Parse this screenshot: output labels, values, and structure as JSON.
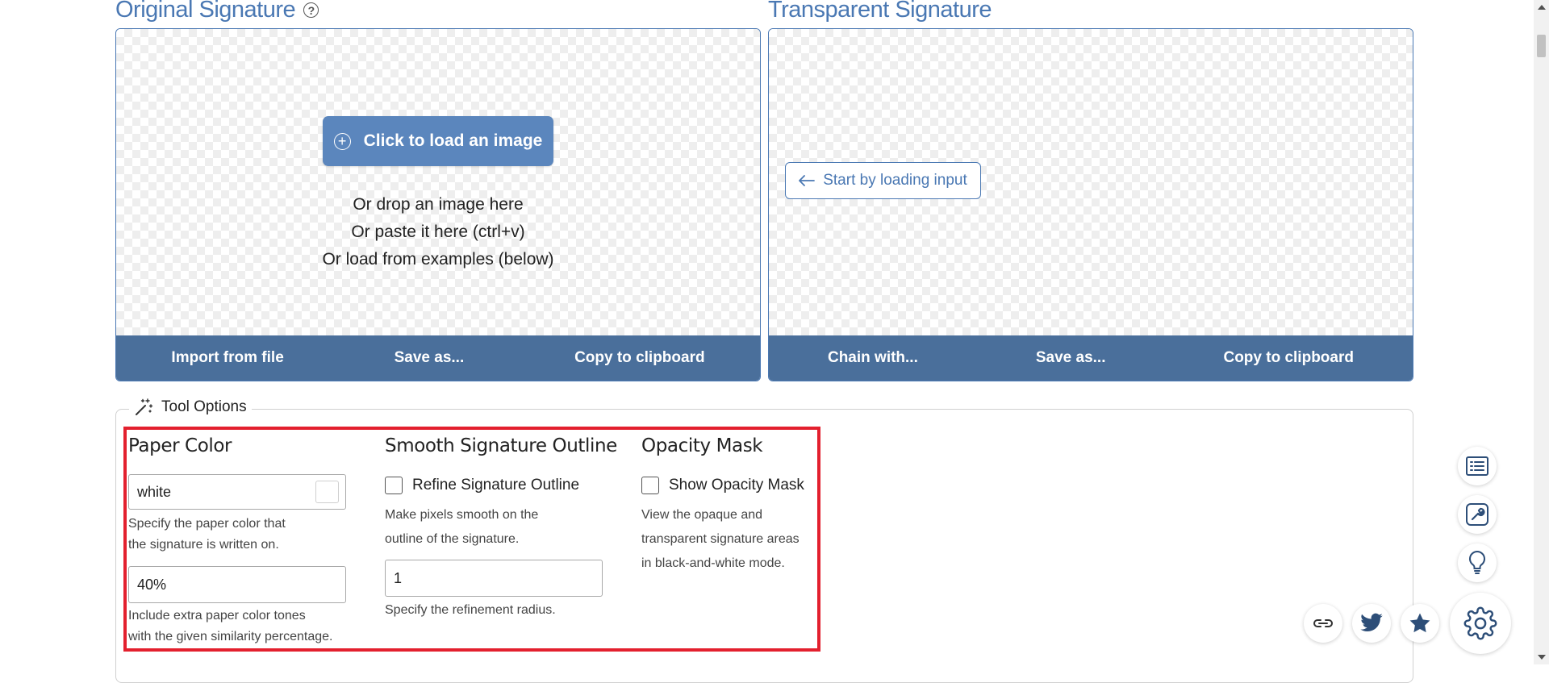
{
  "input_panel": {
    "title": "Original Signature",
    "load_button_label": "Click to load an image",
    "drop_lines": [
      "Or drop an image here",
      "Or paste it here (ctrl+v)",
      "Or load from examples (below)"
    ],
    "toolbar": [
      "Import from file",
      "Save as...",
      "Copy to clipboard"
    ]
  },
  "output_panel": {
    "title": "Transparent Signature",
    "start_button_label": "Start by loading input",
    "toolbar": [
      "Chain with...",
      "Save as...",
      "Copy to clipboard"
    ]
  },
  "tool_options": {
    "legend": "Tool Options",
    "paper_color": {
      "heading": "Paper Color",
      "color_value": "white",
      "color_desc": [
        "Specify the paper color that",
        "the signature is written on."
      ],
      "similarity_value": "40%",
      "similarity_desc": [
        "Include extra paper color tones",
        "with the given similarity percentage."
      ]
    },
    "smooth_outline": {
      "heading": "Smooth Signature Outline",
      "checkbox_label": "Refine Signature Outline",
      "checked": false,
      "desc": [
        "Make pixels smooth on the",
        "outline of the signature."
      ],
      "radius_value": "1",
      "radius_desc": "Specify the refinement radius."
    },
    "opacity_mask": {
      "heading": "Opacity Mask",
      "checkbox_label": "Show Opacity Mask",
      "checked": false,
      "desc": [
        "View the opaque and",
        "transparent signature areas",
        "in black-and-white mode."
      ]
    }
  },
  "floating_actions": {
    "side_icons": [
      "list-icon",
      "wrench-icon",
      "lightbulb-icon"
    ],
    "bottom_icons": [
      "link-icon",
      "twitter-icon",
      "star-icon",
      "gear-icon"
    ]
  },
  "colors": {
    "accent": "#4a78b3",
    "toolbar_bg": "#4a6f9b",
    "load_button_bg": "#5b86bd",
    "highlight_border": "#e3202e",
    "icon_color": "#2d4e78"
  }
}
